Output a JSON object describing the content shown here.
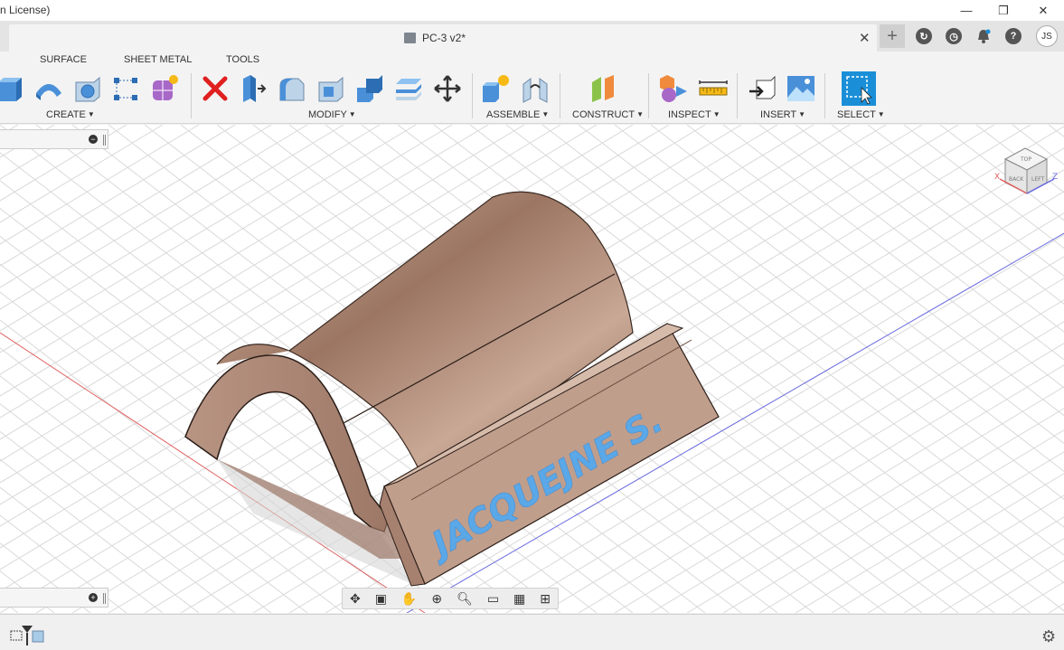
{
  "window": {
    "title_fragment": "n License)",
    "minimize": "—",
    "restore": "❐",
    "close": "✕"
  },
  "tabs": {
    "doc_title": "PC-3 v2*",
    "close": "✕",
    "new_tab": "+",
    "user_initials": "JS"
  },
  "toolbar": {
    "tabs": [
      "SURFACE",
      "SHEET METAL",
      "TOOLS"
    ],
    "groups": {
      "create": "CREATE",
      "modify": "MODIFY",
      "assemble": "ASSEMBLE",
      "construct": "CONSTRUCT",
      "inspect": "INSPECT",
      "insert": "INSERT",
      "select": "SELECT"
    },
    "caret": "▼"
  },
  "model": {
    "engraved_text": "JACQUEJNE S."
  },
  "viewcube": {
    "faces": [
      "TOP",
      "BACK",
      "LEFT"
    ],
    "axes": [
      "X",
      "Z"
    ]
  },
  "panels": {
    "collapse": "−",
    "expand": "+"
  },
  "navbar": {
    "icons": [
      "orbit-icon",
      "look-at-icon",
      "pan-icon",
      "zoom-window-icon",
      "zoom-icon",
      "display-icon",
      "grid-icon",
      "viewports-icon"
    ]
  },
  "colors": {
    "model_fill": "#b08a74",
    "text_blue": "#5aa8e8",
    "select_blue": "#1a8fd8",
    "delete_red": "#e02020"
  }
}
